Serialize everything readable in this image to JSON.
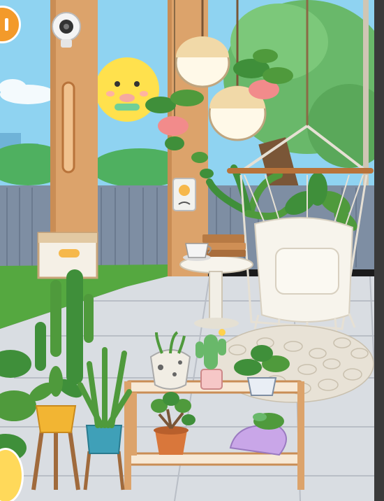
{
  "scene": {
    "name": "sunroom-patio",
    "colors": {
      "sky": "#8fd3f1",
      "wall": "#7e8ea3",
      "floor": "#d9dde2",
      "wood": "#dca36b",
      "leaf": "#4f9a3c",
      "sun": "#ffe14d",
      "accent_orange": "#f39a2a"
    }
  },
  "hud": {
    "pause_icon": "pause-icon",
    "character_icon": "character-face-icon"
  },
  "props": {
    "doorbell_icon": "doorbell-icon",
    "drawer_tag_icon": "drawer-tag-icon"
  }
}
